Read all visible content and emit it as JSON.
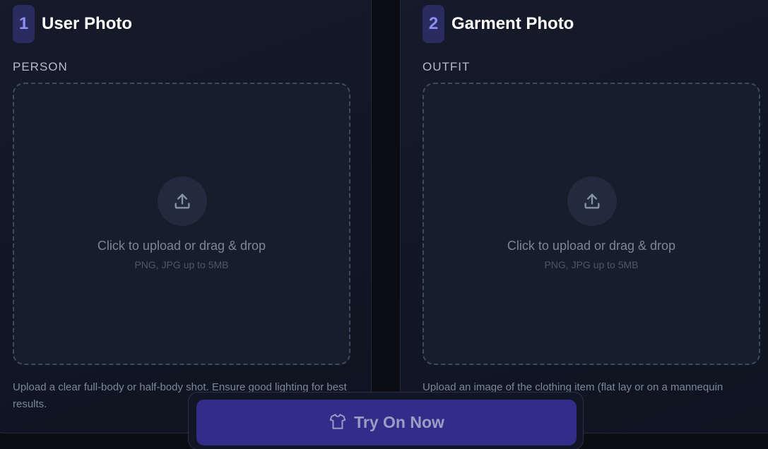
{
  "user_card": {
    "step": "1",
    "title": "User Photo",
    "section_label": "PERSON",
    "dropzone": {
      "main_text": "Click to upload or drag & drop",
      "sub_text": "PNG, JPG up to 5MB"
    },
    "hint": "Upload a clear full-body or half-body shot. Ensure good lighting for best results."
  },
  "garment_card": {
    "step": "2",
    "title": "Garment Photo",
    "section_label": "OUTFIT",
    "dropzone": {
      "main_text": "Click to upload or drag & drop",
      "sub_text": "PNG, JPG up to 5MB"
    },
    "hint": "Upload an image of the clothing item (flat lay or on a mannequin"
  },
  "action": {
    "label": "Try On Now",
    "icon": "shirt-icon"
  },
  "colors": {
    "accent": "#312e8a",
    "badge_bg": "#2a2b5e",
    "badge_text": "#8b8ff5"
  }
}
